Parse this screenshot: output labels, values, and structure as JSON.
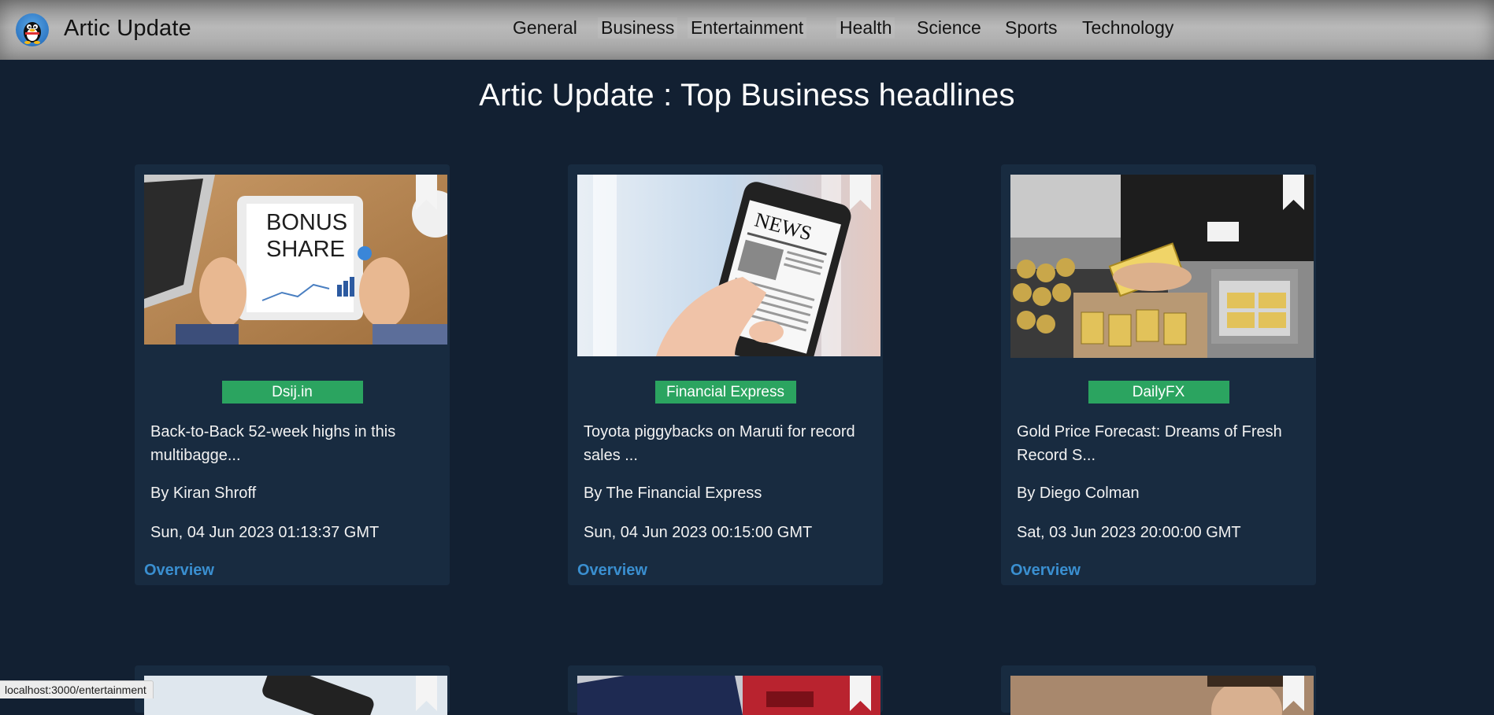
{
  "navbar": {
    "brand": "Artic Update",
    "links": [
      {
        "label": "General"
      },
      {
        "label": "Business"
      },
      {
        "label": "Entertainment"
      },
      {
        "label": "Health"
      },
      {
        "label": "Science"
      },
      {
        "label": "Sports"
      },
      {
        "label": "Technology"
      }
    ]
  },
  "heading": "Artic Update : Top Business headlines",
  "cards": [
    {
      "source": "Dsij.in",
      "title": "Back-to-Back 52-week highs in this multibagge...",
      "author": "By Kiran Shroff",
      "date": "Sun, 04 Jun 2023 01:13:37 GMT",
      "link_label": "Overview",
      "image_text": [
        "BONUS",
        "SHARE"
      ]
    },
    {
      "source": "Financial Express",
      "title": "Toyota piggybacks on Maruti for record sales ...",
      "author": "By The Financial Express",
      "date": "Sun, 04 Jun 2023 00:15:00 GMT",
      "link_label": "Overview",
      "image_text": [
        "NEWS"
      ]
    },
    {
      "source": "DailyFX",
      "title": "Gold Price Forecast: Dreams of Fresh Record S...",
      "author": "By Diego Colman",
      "date": "Sat, 03 Jun 2023 20:00:00 GMT",
      "link_label": "Overview",
      "image_text": []
    }
  ],
  "status_bar": "localhost:3000/entertainment",
  "colors": {
    "page_bg": "#122032",
    "card_bg": "#182b40",
    "badge": "#2ba460",
    "link": "#3a8fd0"
  }
}
